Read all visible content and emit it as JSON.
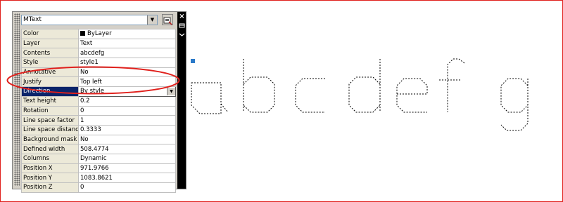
{
  "palette": {
    "object_type": "MText",
    "close_glyph": "×",
    "properties": [
      {
        "name": "Color",
        "value": "ByLayer",
        "has_swatch": true
      },
      {
        "name": "Layer",
        "value": "Text"
      },
      {
        "name": "Contents",
        "value": "abcdefg"
      },
      {
        "name": "Style",
        "value": "style1"
      },
      {
        "name": "Annotative",
        "value": "No"
      },
      {
        "name": "Justify",
        "value": "Top left"
      },
      {
        "name": "Direction",
        "value": "By style",
        "selected": true,
        "dropdown": true
      },
      {
        "name": "Text height",
        "value": "0.2"
      },
      {
        "name": "Rotation",
        "value": "0"
      },
      {
        "name": "Line space factor",
        "value": "1"
      },
      {
        "name": "Line space distance",
        "value": "0.3333"
      },
      {
        "name": "Background mask",
        "value": "No"
      },
      {
        "name": "Defined width",
        "value": "508.4774"
      },
      {
        "name": "Columns",
        "value": "Dynamic"
      },
      {
        "name": "Position X",
        "value": "971.9766"
      },
      {
        "name": "Position Y",
        "value": "1083.8621"
      },
      {
        "name": "Position Z",
        "value": "0"
      }
    ]
  },
  "colors": {
    "selection": "#0a246a",
    "annotation": "#e0201c",
    "grip": "#2b7ac9"
  }
}
